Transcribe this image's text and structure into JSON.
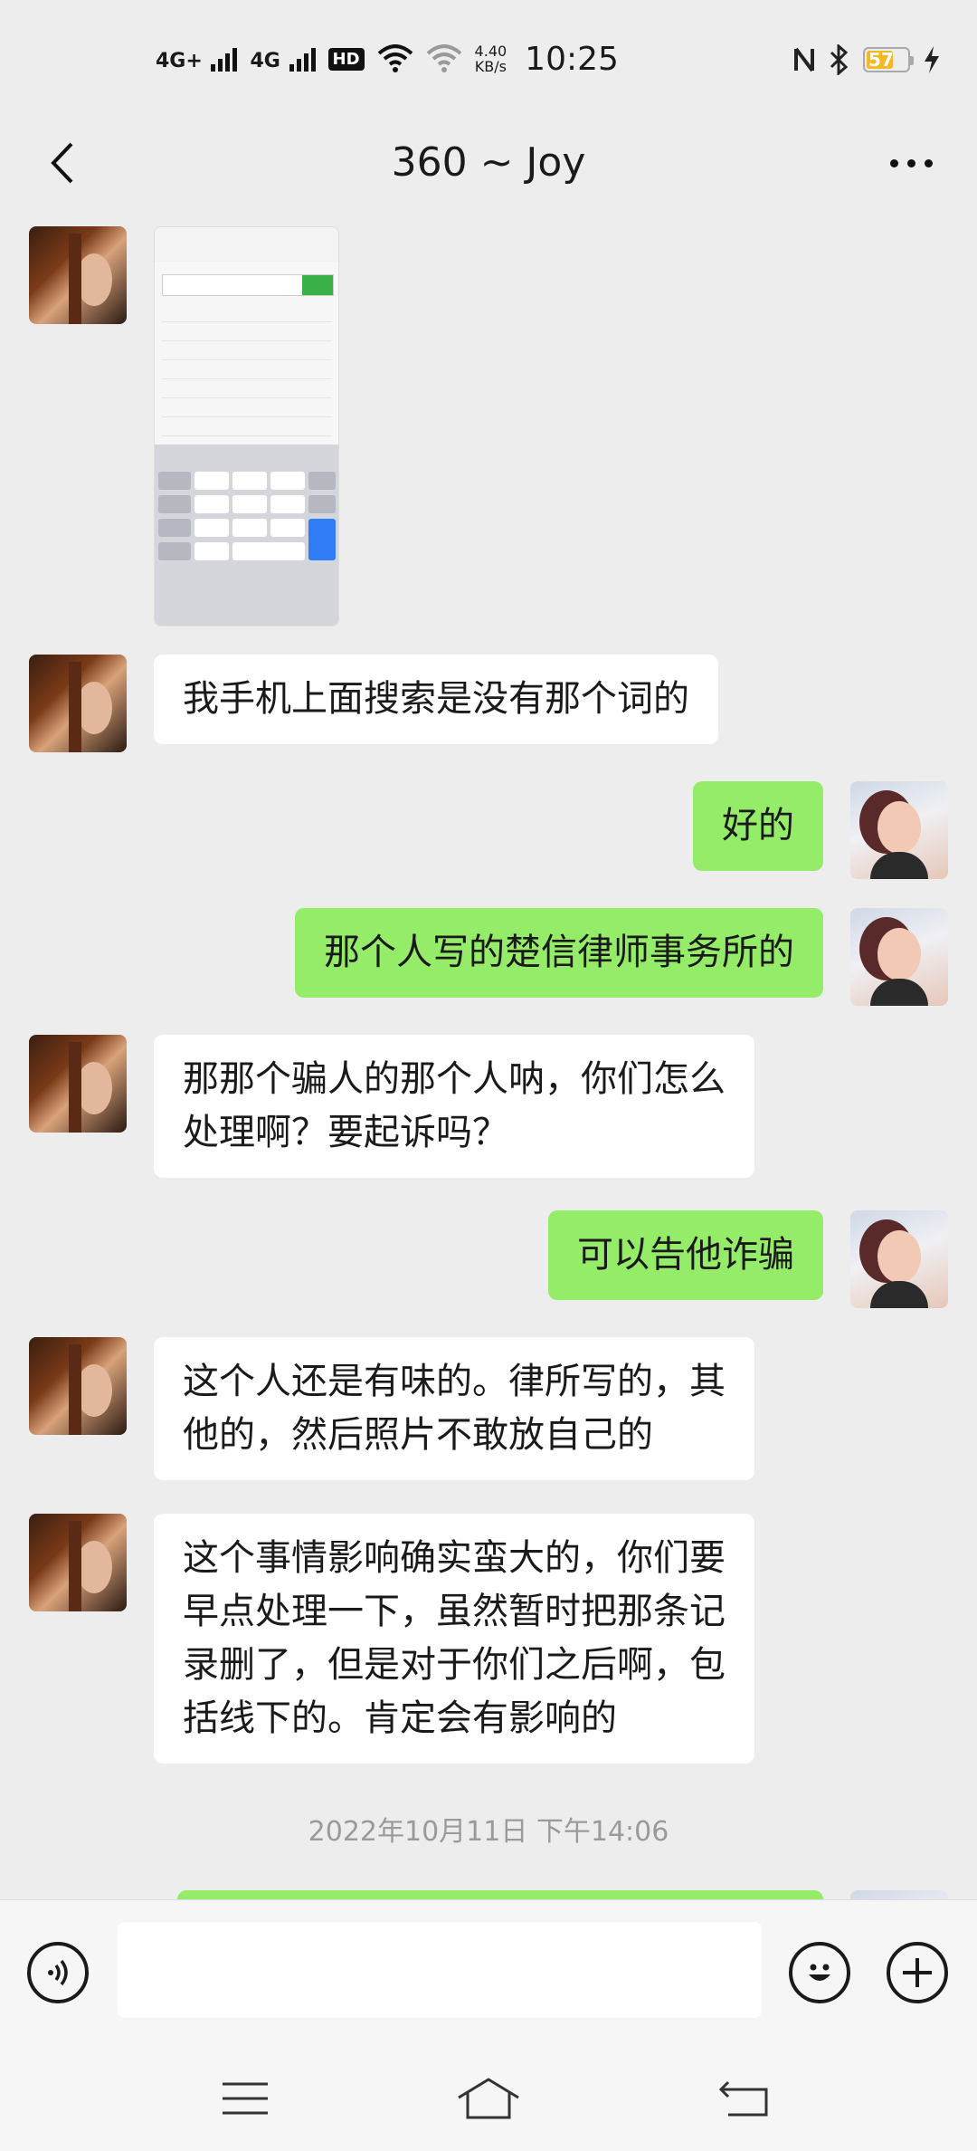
{
  "status_bar": {
    "network1": "4G+",
    "network2": "4G",
    "hd": "HD",
    "speed_value": "4.40",
    "speed_unit": "KB/s",
    "time": "10:25",
    "battery": "57"
  },
  "header": {
    "title": "360 ~ Joy",
    "back_icon": "chevron-left-icon",
    "more_icon": "more-dots-icon"
  },
  "messages": [
    {
      "side": "left",
      "type": "image",
      "image_desc": "search-screenshot"
    },
    {
      "side": "left",
      "type": "text",
      "lines": [
        "我手机上面搜索是没有那个词的"
      ]
    },
    {
      "side": "right",
      "type": "text",
      "lines": [
        "好的"
      ]
    },
    {
      "side": "right",
      "type": "text",
      "lines": [
        "那个人写的楚信律师事务所的"
      ]
    },
    {
      "side": "left",
      "type": "text",
      "lines": [
        "那那个骗人的那个人呐，你们怎么",
        "处理啊？要起诉吗？"
      ]
    },
    {
      "side": "right",
      "type": "text",
      "lines": [
        "可以告他诈骗"
      ]
    },
    {
      "side": "left",
      "type": "text",
      "lines": [
        "这个人还是有味的。律所写的，其",
        "他的，然后照片不敢放自己的"
      ]
    },
    {
      "side": "left",
      "type": "text",
      "lines": [
        "这个事情影响确实蛮大的，你们要",
        "早点处理一下，虽然暂时把那条记",
        "录删了，但是对于你们之后啊，包",
        "括线下的。肯定会有影响的"
      ]
    }
  ],
  "timestamp": "2022年10月11日 下午14:06",
  "input_bar": {
    "voice_icon": "voice-icon",
    "placeholder": "",
    "emoji_icon": "emoji-icon",
    "plus_icon": "plus-icon"
  },
  "nav_bar": {
    "menu_icon": "menu-icon",
    "home_icon": "home-icon",
    "back_icon": "back-icon"
  },
  "colors": {
    "background": "#ededed",
    "bubble_right": "#95ec69",
    "bubble_left": "#ffffff",
    "battery": "#f3b823"
  }
}
